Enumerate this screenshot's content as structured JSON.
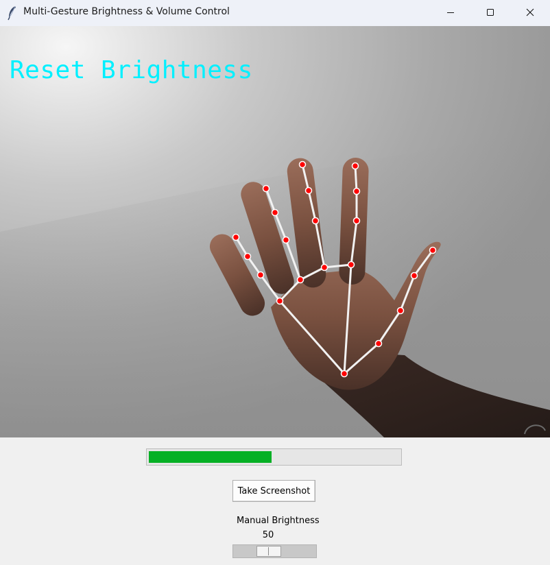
{
  "window": {
    "title": "Multi-Gesture Brightness & Volume Control",
    "app_icon": "feather-icon",
    "controls": [
      "minimize-icon",
      "maximize-icon",
      "close-icon"
    ]
  },
  "camera": {
    "overlay_text": "Reset Brightness",
    "overlay_color": "#00f0ff",
    "landmark_color": "#ff0000",
    "connection_color": "#f2f2f2"
  },
  "progress": {
    "value_fraction": 0.49,
    "fill_color": "#06b025"
  },
  "buttons": {
    "screenshot_label": "Take Screenshot"
  },
  "brightness_scale": {
    "label": "Manual Brightness",
    "value": "50",
    "min": 0,
    "max": 100
  }
}
